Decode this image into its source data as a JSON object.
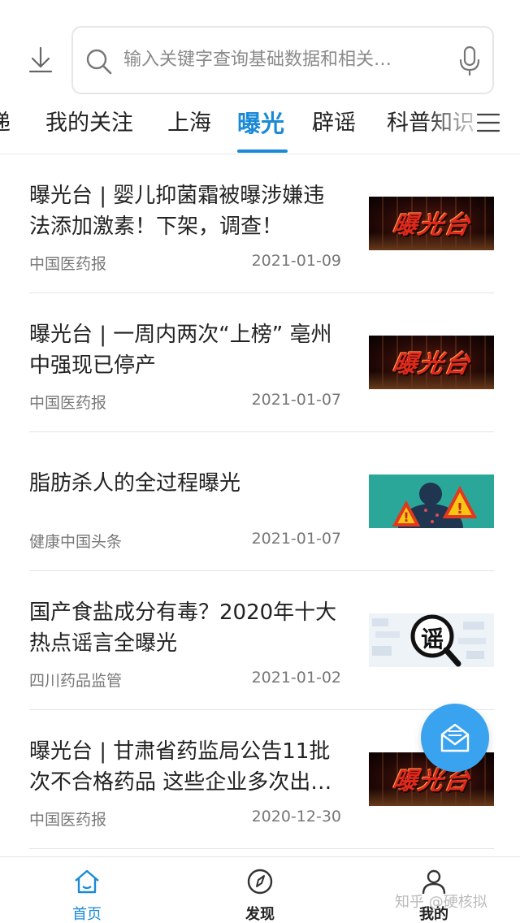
{
  "search": {
    "placeholder": "输入关键字查询基础数据和相关…"
  },
  "tabs": [
    {
      "label": "递",
      "active": false
    },
    {
      "label": "我的关注",
      "active": false
    },
    {
      "label": "上海",
      "active": false
    },
    {
      "label": "曝光",
      "active": true
    },
    {
      "label": "辟谣",
      "active": false
    },
    {
      "label": "科普知识",
      "active": false
    }
  ],
  "news": [
    {
      "title": "曝光台 | 婴儿抑菌霜被曝涉嫌违法添加激素！下架，调查！",
      "source": "中国医药报",
      "date": "2021-01-09",
      "thumb_icon": "exposure-stage-image",
      "thumb_text": "曝光台"
    },
    {
      "title": "曝光台 | 一周内两次“上榜” 亳州中强现已停产",
      "source": "中国医药报",
      "date": "2021-01-07",
      "thumb_icon": "exposure-stage-image",
      "thumb_text": "曝光台"
    },
    {
      "title": "脂肪杀人的全过程曝光",
      "source": "健康中国头条",
      "date": "2021-01-07",
      "thumb_icon": "warning-body-image"
    },
    {
      "title": "国产食盐成分有毒？2020年十大热点谣言全曝光",
      "source": "四川药品监管",
      "date": "2021-01-02",
      "thumb_icon": "rumor-magnifier-image",
      "thumb_text": "谣"
    },
    {
      "title": "曝光台 | 甘肃省药监局公告11批次不合格药品 这些企业多次出…",
      "source": "中国医药报",
      "date": "2020-12-30",
      "thumb_icon": "exposure-stage-image",
      "thumb_text": "曝光台"
    }
  ],
  "bottom_nav": [
    {
      "label": "首页",
      "icon": "home-icon",
      "active": true
    },
    {
      "label": "发现",
      "icon": "compass-icon",
      "active": false
    },
    {
      "label": "我的",
      "icon": "user-icon",
      "active": false
    }
  ],
  "watermark": "知乎 @硬核拟",
  "colors": {
    "accent": "#1a8ad6",
    "fab": "#3aa3f0"
  }
}
